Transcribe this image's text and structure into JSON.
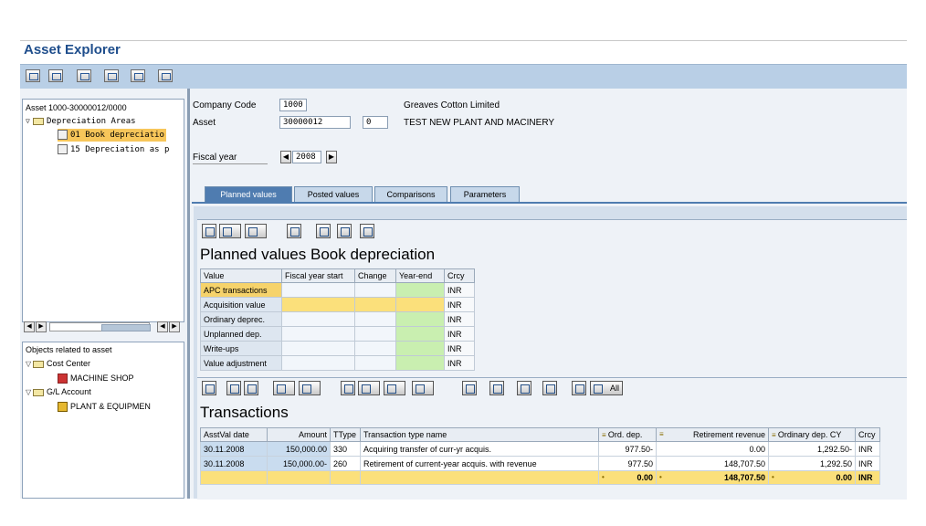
{
  "window": {
    "title": "Asset Explorer"
  },
  "toolbar": {
    "icons": [
      "refresh-icon",
      "overview-icon",
      "plan-icon",
      "table-icon",
      "grid-icon",
      "list-icon"
    ]
  },
  "left_tree": {
    "root": "Asset 1000-30000012/0000",
    "depreciation_areas": "Depreciation Areas",
    "areas": [
      "01 Book depreciatio",
      "15 Depreciation as p"
    ]
  },
  "objects_tree": {
    "title": "Objects related to asset",
    "cost_center": "Cost Center",
    "cost_center_item": "MACHINE SHOP",
    "gl_account": "G/L Account",
    "gl_item": "PLANT & EQUIPMEN"
  },
  "header": {
    "company_code_label": "Company Code",
    "company_code": "1000",
    "company_name": "Greaves Cotton Limited",
    "asset_label": "Asset",
    "asset": "30000012",
    "asset_sub": "0",
    "asset_name": "TEST NEW  PLANT AND MACINERY",
    "fiscal_year_label": "Fiscal year",
    "fiscal_year": "2008"
  },
  "tabs": [
    "Planned values",
    "Posted values",
    "Comparisons",
    "Parameters"
  ],
  "planned": {
    "title": "Planned values Book depreciation",
    "columns": [
      "Value",
      "Fiscal year start",
      "Change",
      "Year-end",
      "Crcy"
    ],
    "rows": [
      {
        "label": "APC transactions",
        "crcy": "INR"
      },
      {
        "label": "Acquisition value",
        "crcy": "INR"
      },
      {
        "label": "Ordinary deprec.",
        "crcy": "INR"
      },
      {
        "label": "Unplanned dep.",
        "crcy": "INR"
      },
      {
        "label": "Write-ups",
        "crcy": "INR"
      },
      {
        "label": "Value adjustment",
        "crcy": "INR"
      }
    ]
  },
  "transactions": {
    "title": "Transactions",
    "all_label": "All",
    "columns": [
      "AsstVal date",
      "Amount",
      "TType",
      "Transaction type name",
      "Ord. dep.",
      "Retirement revenue",
      "Ordinary dep. CY",
      "Crcy"
    ],
    "rows": [
      {
        "date": "30.11.2008",
        "amount": "150,000.00",
        "ttype": "330",
        "name": "Acquiring transfer of curr-yr acquis.",
        "ord_dep": "977.50-",
        "ret_rev": "0.00",
        "ord_dep_cy": "1,292.50-",
        "crcy": "INR"
      },
      {
        "date": "30.11.2008",
        "amount": "150,000.00-",
        "ttype": "260",
        "name": "Retirement of current-year acquis. with revenue",
        "ord_dep": "977.50",
        "ret_rev": "148,707.50",
        "ord_dep_cy": "1,292.50",
        "crcy": "INR"
      }
    ],
    "totals": {
      "ord_dep": "0.00",
      "ret_rev": "148,707.50",
      "ord_dep_cy": "0.00",
      "crcy": "INR"
    }
  }
}
